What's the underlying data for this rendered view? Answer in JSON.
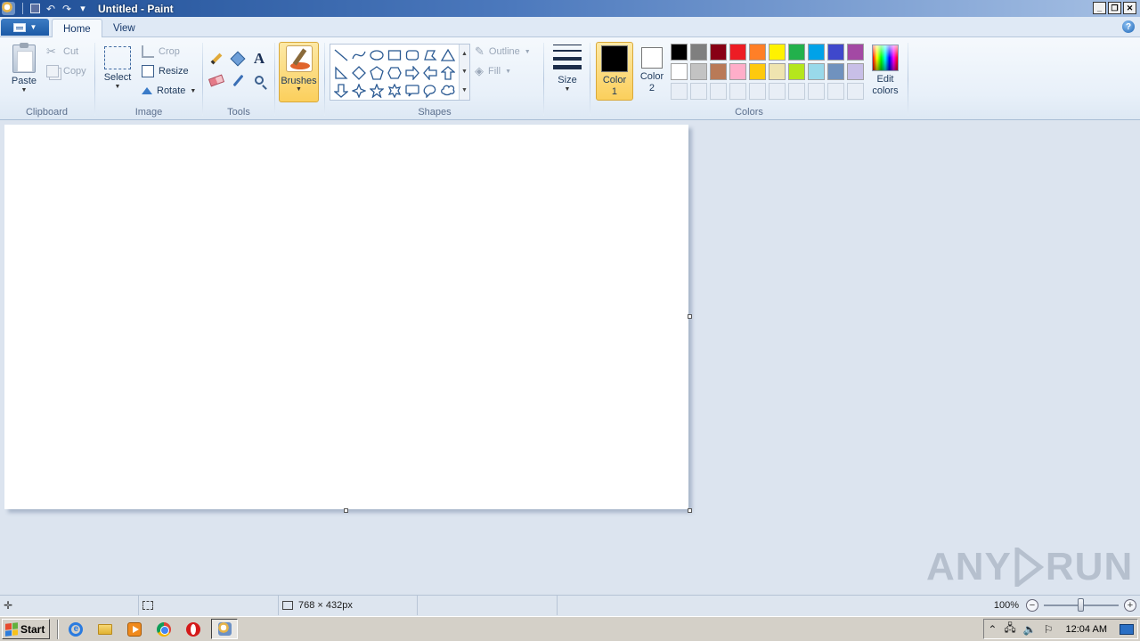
{
  "window": {
    "title": "Untitled - Paint",
    "controls": {
      "minimize": "_",
      "restore": "❐",
      "close": "✕"
    }
  },
  "quick_access": {
    "undo_icon": "↶",
    "redo_icon": "↷",
    "customize_icon": "▾"
  },
  "tabs": {
    "home": "Home",
    "view": "View",
    "help_icon": "?"
  },
  "clipboard": {
    "paste": "Paste",
    "cut": "Cut",
    "copy": "Copy",
    "group_label": "Clipboard"
  },
  "image": {
    "select": "Select",
    "crop": "Crop",
    "resize": "Resize",
    "rotate": "Rotate",
    "group_label": "Image"
  },
  "tools": {
    "group_label": "Tools",
    "text_glyph": "A"
  },
  "brushes": {
    "label": "Brushes"
  },
  "shapes": {
    "group_label": "Shapes",
    "outline": "Outline",
    "fill": "Fill",
    "items": [
      "line",
      "curve",
      "oval",
      "rectangle",
      "rounded-rectangle",
      "polygon",
      "triangle",
      "right-triangle",
      "diamond",
      "pentagon",
      "hexagon",
      "right-arrow",
      "left-arrow",
      "up-arrow",
      "down-arrow",
      "four-point-star",
      "five-point-star",
      "six-point-star",
      "rounded-callout",
      "oval-callout",
      "cloud-callout"
    ]
  },
  "size": {
    "label": "Size"
  },
  "colors": {
    "color1_label": "Color\n1",
    "color2_label": "Color\n2",
    "color1": "#000000",
    "color2": "#ffffff",
    "edit_label": "Edit\ncolors",
    "group_label": "Colors",
    "palette_row1": [
      "#000000",
      "#7f7f7f",
      "#880015",
      "#ed1c24",
      "#ff7f27",
      "#fff200",
      "#22b14c",
      "#00a2e8",
      "#3f48cc",
      "#a349a4"
    ],
    "palette_row2": [
      "#ffffff",
      "#c3c3c3",
      "#b97a57",
      "#ffaec9",
      "#ffc90e",
      "#efe4b0",
      "#b5e61d",
      "#99d9ea",
      "#7092be",
      "#c8bfe7"
    ],
    "palette_row3_count": 10
  },
  "statusbar": {
    "canvas_size": "768 × 432px",
    "zoom": "100%",
    "zoom_minus": "−",
    "zoom_plus": "+",
    "zoom_level_fraction": 0.5
  },
  "watermark": {
    "left": "ANY",
    "right": "RUN"
  },
  "taskbar": {
    "start": "Start",
    "clock": "12:04 AM",
    "tray_up_icon": "⌃",
    "tray_flag_icon": "⚐",
    "tray_sound_icon": "🔈"
  }
}
